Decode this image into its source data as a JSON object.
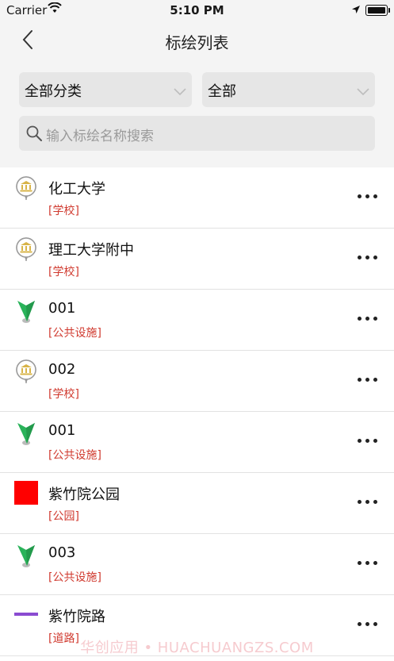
{
  "status_bar": {
    "carrier": "Carrier",
    "time": "5:10 PM"
  },
  "nav": {
    "title": "标绘列表",
    "back_icon": "chevron-left-icon"
  },
  "filters": {
    "category": "全部分类",
    "scope": "全部"
  },
  "search": {
    "placeholder": "输入标绘名称搜索"
  },
  "items": [
    {
      "name": "化工大学",
      "category": "[学校]",
      "icon": "school-pin-icon"
    },
    {
      "name": "理工大学附中",
      "category": "[学校]",
      "icon": "school-pin-icon"
    },
    {
      "name": "001",
      "category": "[公共设施]",
      "icon": "green-marker-icon"
    },
    {
      "name": "002",
      "category": "[学校]",
      "icon": "school-pin-icon"
    },
    {
      "name": "001",
      "category": "[公共设施]",
      "icon": "green-marker-icon"
    },
    {
      "name": "紫竹院公园",
      "category": "[公园]",
      "icon": "red-square-icon"
    },
    {
      "name": "003",
      "category": "[公共设施]",
      "icon": "green-marker-icon"
    },
    {
      "name": "紫竹院路",
      "category": "[道路]",
      "icon": "purple-line-icon"
    }
  ],
  "colors": {
    "category_text": "#d03a2f",
    "park": "#ff0000",
    "road": "#8a4bd1",
    "marker": "#2ab35a"
  },
  "watermark": "华创应用 • HUACHUANGZS.COM"
}
